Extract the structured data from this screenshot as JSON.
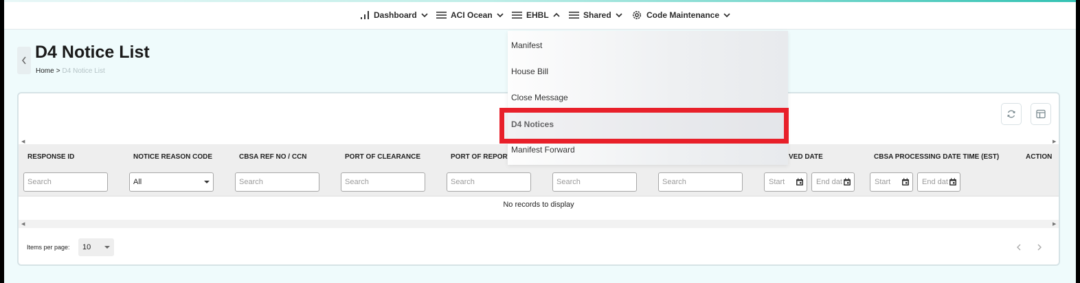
{
  "nav": {
    "items": [
      {
        "label": "Dashboard",
        "icon": "bar-chart-icon"
      },
      {
        "label": "ACI Ocean",
        "icon": "hamburger-icon"
      },
      {
        "label": "EHBL",
        "icon": "hamburger-icon"
      },
      {
        "label": "Shared",
        "icon": "hamburger-icon"
      },
      {
        "label": "Code Maintenance",
        "icon": "gear-icon"
      }
    ]
  },
  "page": {
    "title": "D4 Notice List",
    "breadcrumb": {
      "home": "Home",
      "separator": ">",
      "current": "D4 Notice List"
    }
  },
  "dropdown": {
    "items": [
      {
        "label": "Manifest"
      },
      {
        "label": "House Bill"
      },
      {
        "label": "Close Message"
      },
      {
        "label": "D4 Notices",
        "active": true
      },
      {
        "label": "Manifest Forward"
      }
    ]
  },
  "table": {
    "columns": [
      "RESPONSE ID",
      "NOTICE REASON CODE",
      "CBSA REF NO / CCN",
      "PORT OF CLEARANCE",
      "PORT OF REPORT",
      "",
      "",
      "VED DATE",
      "CBSA PROCESSING DATE TIME (EST)",
      "ACTION"
    ],
    "filters": {
      "search_placeholder": "Search",
      "select_value": "All",
      "date_start": "Start",
      "date_end": "End date"
    },
    "empty_message": "No records to display"
  },
  "paginator": {
    "items_per_page_label": "Items per page:",
    "items_per_page_value": "10"
  },
  "colors": {
    "accent": "#33c2b3",
    "highlight": "#e8202a",
    "page_bg": "#effbfc"
  }
}
